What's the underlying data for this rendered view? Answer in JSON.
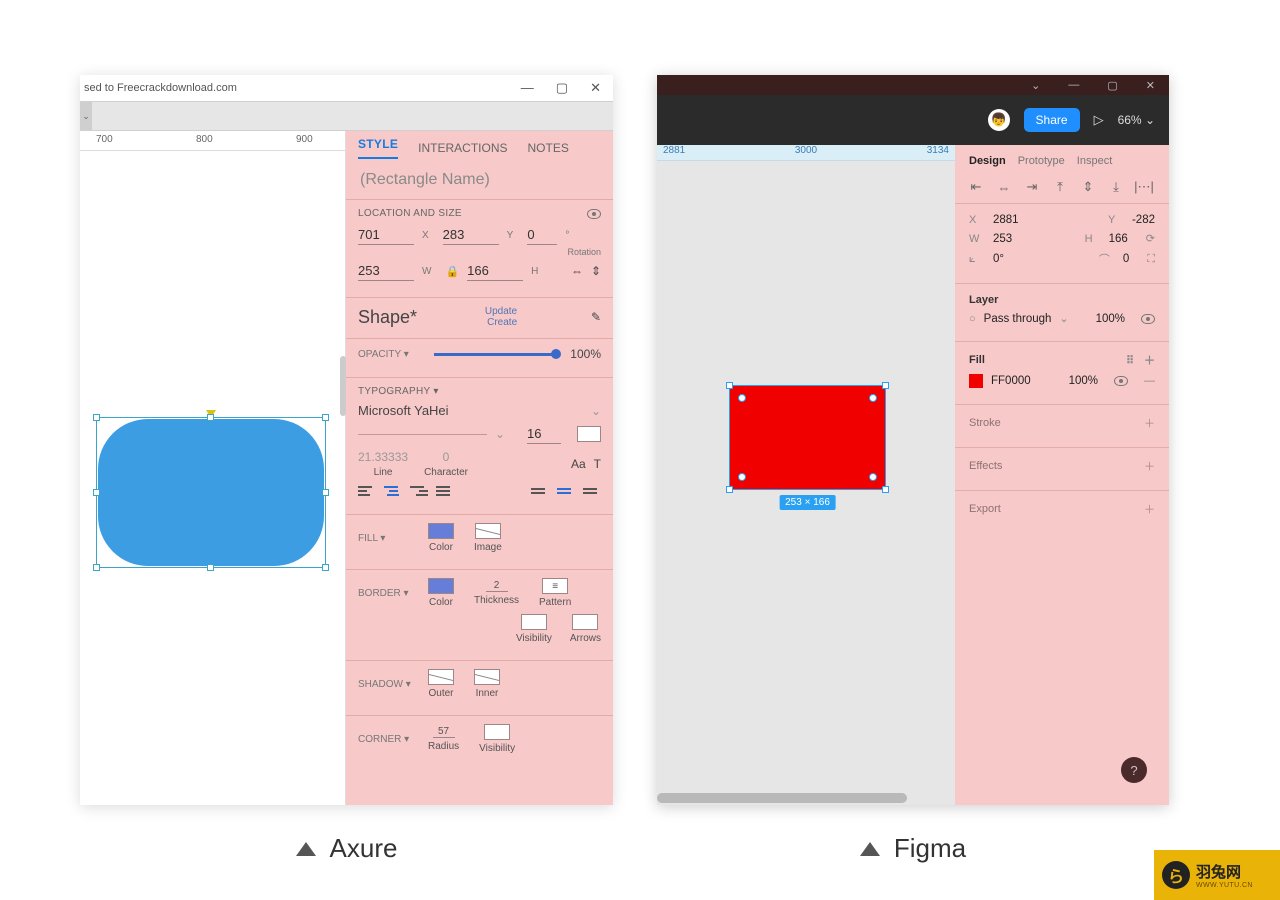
{
  "captions": {
    "axure": "Axure",
    "figma": "Figma"
  },
  "axure": {
    "titlebar": "sed to Freecrackdownload.com",
    "ruler": [
      "700",
      "800",
      "900"
    ],
    "tabs": {
      "style": "STYLE",
      "interactions": "INTERACTIONS",
      "notes": "NOTES"
    },
    "name_placeholder": "(Rectangle Name)",
    "loc_size_label": "LOCATION AND SIZE",
    "x": "701",
    "y": "283",
    "rot": "0",
    "rot_lbl": "Rotation",
    "w": "253",
    "h": "166",
    "shape_label": "Shape*",
    "update": "Update",
    "create": "Create",
    "opacity_label": "OPACITY ▾",
    "opacity_val": "100%",
    "typo_label": "TYPOGRAPHY ▾",
    "font": "Microsoft YaHei",
    "font_size": "16",
    "line_height": "21.33333",
    "line_lbl": "Line",
    "char_spacing": "0",
    "char_lbl": "Character",
    "fill_label": "FILL ▾",
    "fill_color": "Color",
    "fill_image": "Image",
    "border_label": "BORDER ▾",
    "thickness": "2",
    "thick_lbl": "Thickness",
    "pattern_lbl": "Pattern",
    "vis_lbl": "Visibility",
    "arrows_lbl": "Arrows",
    "shadow_label": "SHADOW ▾",
    "outer": "Outer",
    "inner": "Inner",
    "corner_label": "CORNER ▾",
    "radius": "57",
    "radius_lbl": "Radius"
  },
  "figma": {
    "share": "Share",
    "zoom": "66% ",
    "avatar_emoji": "👦",
    "ruler": [
      "2881",
      "3000",
      "3134"
    ],
    "dim_badge": "253 × 166",
    "tabs": {
      "design": "Design",
      "prototype": "Prototype",
      "inspect": "Inspect"
    },
    "x": "2881",
    "y": "-282",
    "w": "253",
    "h": "166",
    "rot": "0°",
    "corner": "0",
    "layer_label": "Layer",
    "blend": "Pass through",
    "layer_opacity": "100%",
    "fill_label": "Fill",
    "fill_hex": "FF0000",
    "fill_opacity": "100%",
    "stroke_label": "Stroke",
    "effects_label": "Effects",
    "export_label": "Export",
    "help": "?"
  },
  "watermark": {
    "title": "羽兔网",
    "sub": "WWW.YUTU.CN"
  }
}
